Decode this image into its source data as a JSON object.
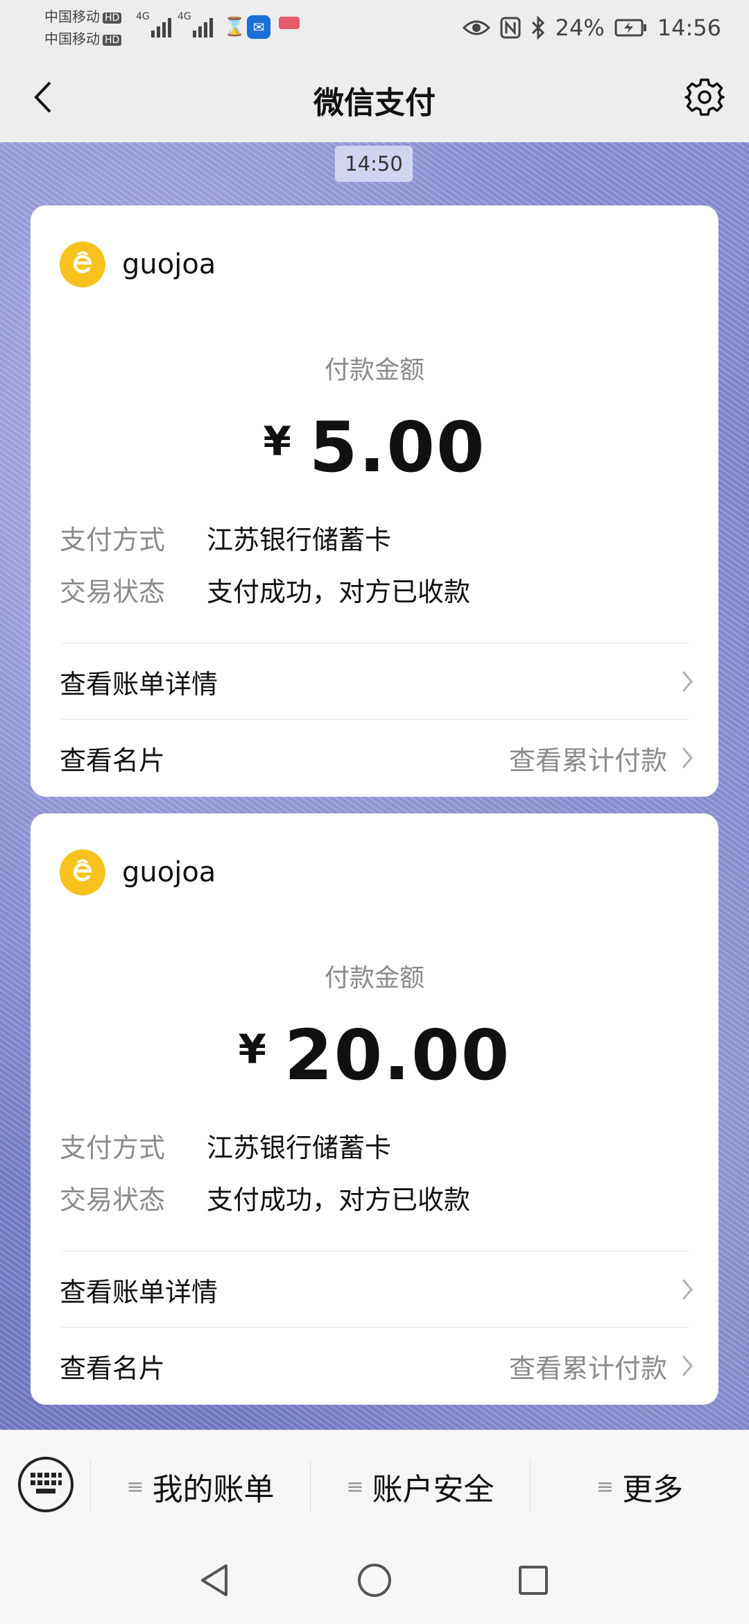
{
  "status_bar": {
    "carrier1": "中国移动",
    "carrier2": "中国移动",
    "hd_label": "HD",
    "net1": "4G",
    "net2": "4G",
    "battery": "24%",
    "time": "14:56"
  },
  "nav": {
    "title": "微信支付"
  },
  "chat": {
    "time_label": "14:50"
  },
  "payments": [
    {
      "merchant": "guojoa",
      "amount_label": "付款金额",
      "currency": "¥",
      "amount": "5.00",
      "method_key": "支付方式",
      "method_value": "江苏银行储蓄卡",
      "status_key": "交易状态",
      "status_value": "支付成功，对方已收款",
      "bill_detail": "查看账单详情",
      "view_card": "查看名片",
      "view_total": "查看累计付款"
    },
    {
      "merchant": "guojoa",
      "amount_label": "付款金额",
      "currency": "¥",
      "amount": "20.00",
      "method_key": "支付方式",
      "method_value": "江苏银行储蓄卡",
      "status_key": "交易状态",
      "status_value": "支付成功，对方已收款",
      "bill_detail": "查看账单详情",
      "view_card": "查看名片",
      "view_total": "查看累计付款"
    }
  ],
  "bottom_menu": {
    "items": [
      {
        "label": "我的账单"
      },
      {
        "label": "账户安全"
      },
      {
        "label": "更多"
      }
    ]
  },
  "colors": {
    "merchant_logo": "#f7c21d",
    "chat_background": "#7d83d0"
  }
}
